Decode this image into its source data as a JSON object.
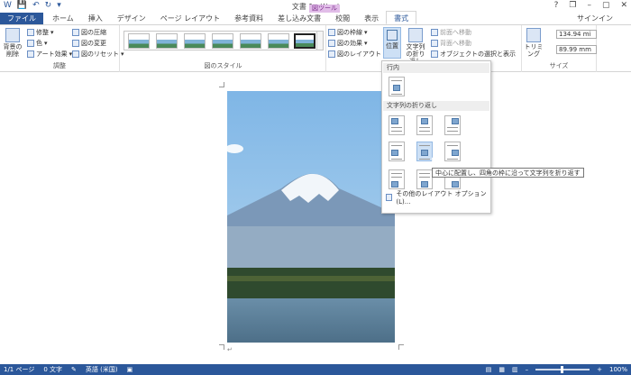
{
  "window": {
    "title": "文書 1 - Word",
    "help": "?",
    "min": "–",
    "max": "▢",
    "close": "✕",
    "restore": "❐"
  },
  "picture_tools_label": "図ツール",
  "tabs": [
    "ファイル",
    "ホーム",
    "挿入",
    "デザイン",
    "ページ レイアウト",
    "参考資料",
    "差し込み文書",
    "校閲",
    "表示",
    "書式"
  ],
  "signin": "サインイン",
  "ribbon": {
    "adjust": {
      "remove_bg": "背景の削除",
      "correct": "修整",
      "color": "色",
      "art": "アート効果",
      "compress": "図の圧縮",
      "change": "図の変更",
      "reset": "図のリセット",
      "label": "調整"
    },
    "styles": {
      "label": "図のスタイル",
      "border": "図の枠線",
      "effects": "図の効果",
      "layout": "図のレイアウト"
    },
    "arrange": {
      "position": "位置",
      "wrap": "文字列の折り返し",
      "forward": "前面へ移動",
      "backward": "背面へ移動",
      "selection": "オブジェクトの選択と表示"
    },
    "size": {
      "crop": "トリミング",
      "height": "134.94 mi",
      "width": "89.99 mm",
      "label": "サイズ"
    }
  },
  "dropdown": {
    "inline_header": "行内",
    "wrap_header": "文字列の折り返し",
    "more": "その他のレイアウト オプション(L)..."
  },
  "tooltip": "中心に配置し、四角の枠に沿って文字列を折り返す",
  "status": {
    "page": "1/1 ページ",
    "words": "0 文字",
    "lang": "英語 (米国)",
    "zoom": "100%"
  }
}
